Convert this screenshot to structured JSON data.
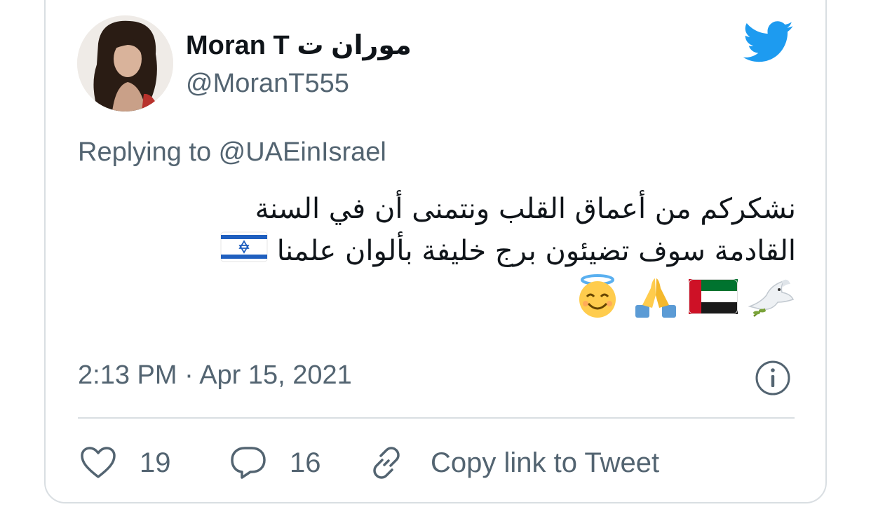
{
  "author": {
    "display_name": "Moran T موران ت",
    "handle": "@MoranT555",
    "avatar_icon": "profile-photo"
  },
  "reply_to": "Replying to @UAEinIsrael",
  "tweet": {
    "line1": "نشكركم من أعماق القلب ونتمنى أن في السنة",
    "line2": "القادمة سوف تضيئون برج خليفة بألوان علمنا",
    "emojis": [
      "israel-flag",
      "dove",
      "uae-flag",
      "folded-hands",
      "smiling-face-with-halo"
    ]
  },
  "timestamp": "2:13 PM · Apr 15, 2021",
  "actions": {
    "likes": "19",
    "replies": "16",
    "copy_link": "Copy link to Tweet"
  },
  "colors": {
    "brand": "#1d9bf0",
    "text": "#0f1419",
    "muted": "#536471",
    "border": "#d9dee2"
  }
}
